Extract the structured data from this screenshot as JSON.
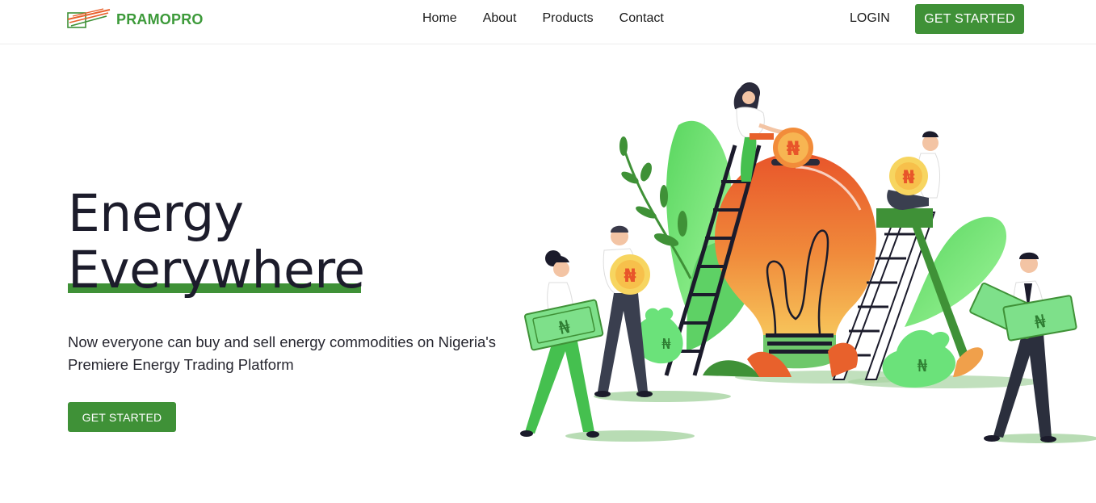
{
  "brand": {
    "name": "PRAMOPRO",
    "color": "#3f9137",
    "accent_orange": "#e8612c"
  },
  "nav": {
    "links": [
      {
        "label": "Home"
      },
      {
        "label": "About"
      },
      {
        "label": "Products"
      },
      {
        "label": "Contact"
      }
    ],
    "login_label": "LOGIN",
    "cta_label": "GET STARTED"
  },
  "hero": {
    "title_line1": "Energy",
    "title_line2": "Everywhere",
    "subtitle": "Now everyone can buy and sell energy commodities on Nigeria's Premiere Energy Trading Platform",
    "cta_label": "GET STARTED"
  },
  "illustration": {
    "currency_symbol": "₦",
    "icon": "lightbulb-money-illustration"
  }
}
